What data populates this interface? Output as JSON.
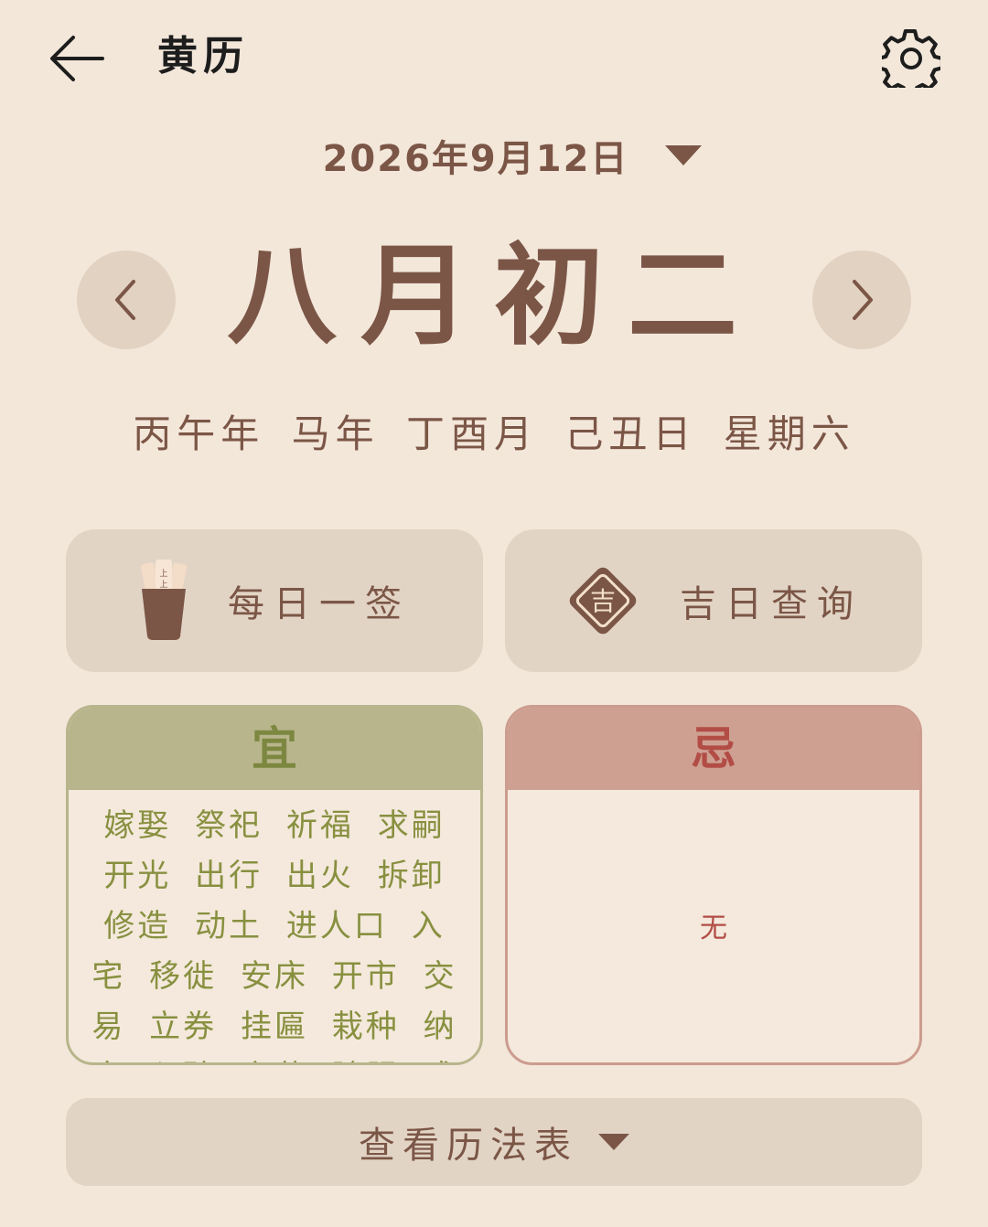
{
  "header": {
    "title": "黄历",
    "back_icon": "arrow-left-icon",
    "settings_icon": "gear-icon"
  },
  "date_selector": {
    "date": "2026年9月12日",
    "dropdown_icon": "caret-down-icon"
  },
  "lunar": {
    "date": "八月初二",
    "prev_icon": "chevron-left-icon",
    "next_icon": "chevron-right-icon"
  },
  "ganzhi": "丙午年 马年 丁酉月 己丑日 星期六",
  "actions": [
    {
      "label": "每日一签",
      "icon": "fortune-sticks-icon"
    },
    {
      "label": "吉日查询",
      "icon": "lucky-diamond-icon",
      "icon_text": "吉"
    }
  ],
  "yi": {
    "title": "宜",
    "items": "嫁娶 祭祀 祈福 求嗣 开光 出行 出火 拆卸 修造 动土 进人口 入宅 移徙 安床 开市 交易 立券 挂匾 栽种 纳畜 入殓 安葬 除服 成服"
  },
  "ji": {
    "title": "忌",
    "items": "无"
  },
  "calendar_table": {
    "label": "查看历法表"
  },
  "colors": {
    "background": "#f3e7da",
    "primary_text": "#7b5646",
    "card": "#e2d4c5",
    "yi_header": "#b8b58c",
    "yi_text": "#889040",
    "ji_header": "#cea092",
    "ji_text": "#b24d46"
  }
}
